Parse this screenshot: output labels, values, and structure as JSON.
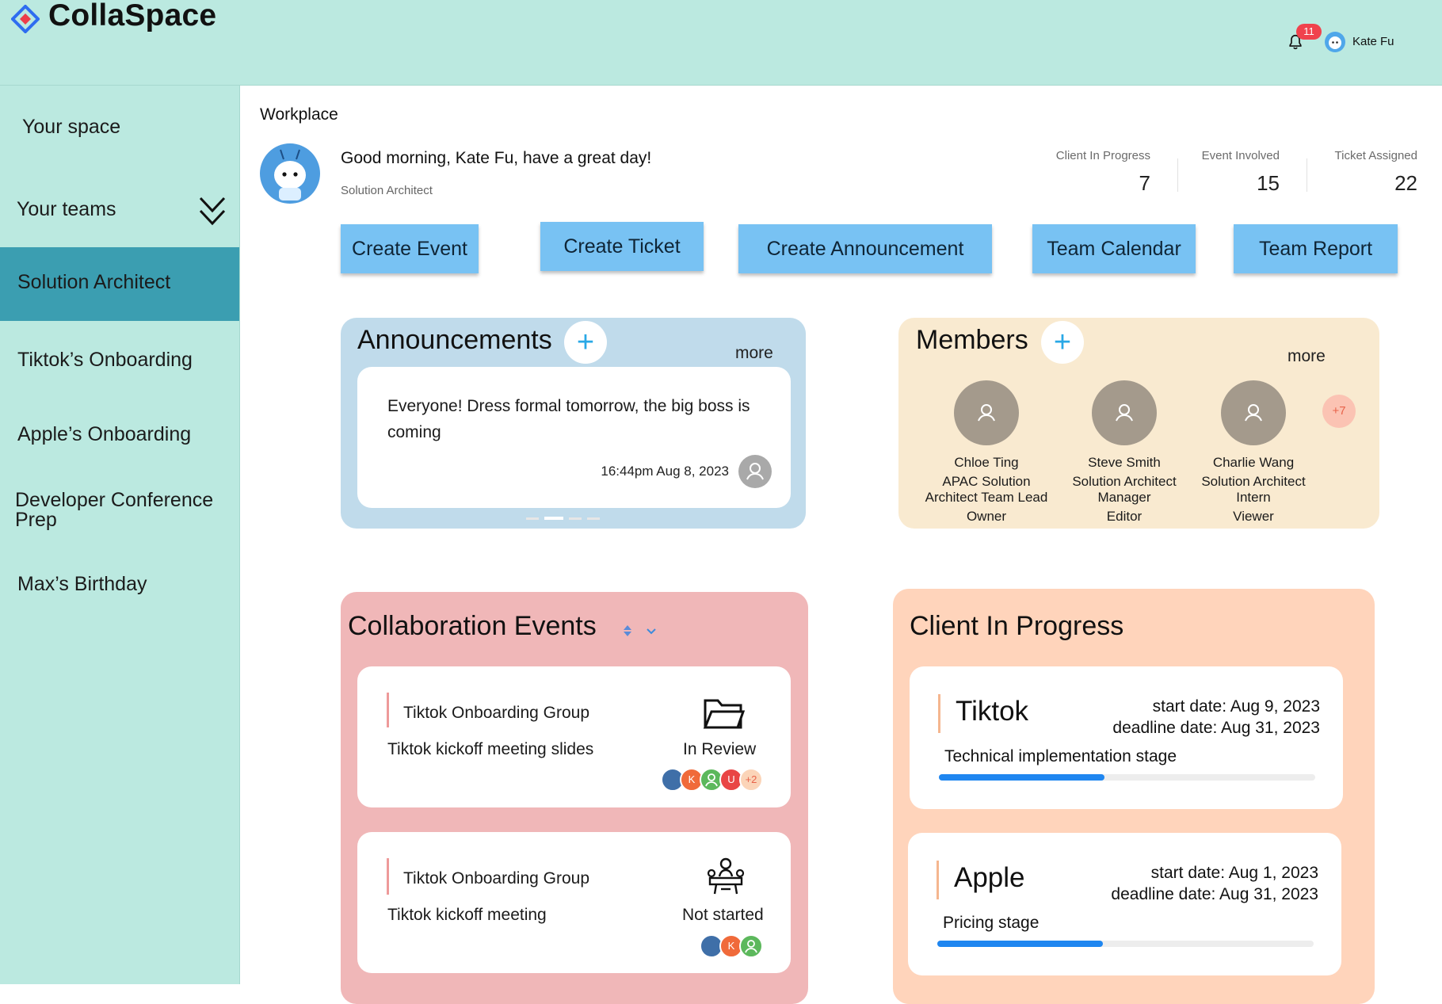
{
  "app": {
    "name": "CollaSpace"
  },
  "header": {
    "notification_count": "11",
    "user_name": "Kate Fu"
  },
  "sidebar": {
    "your_space": "Your space",
    "your_teams": "Your teams",
    "teams": [
      {
        "label": "Solution Architect",
        "active": true
      },
      {
        "label": "Tiktok’s Onboarding"
      },
      {
        "label": "Apple’s Onboarding"
      },
      {
        "label": "Developer Conference Prep"
      },
      {
        "label": "Max’s Birthday"
      }
    ]
  },
  "main": {
    "section_label": "Workplace",
    "greeting": "Good morning, Kate Fu, have a great day!",
    "role": "Solution Architect",
    "stats": [
      {
        "label": "Client In Progress",
        "value": "7"
      },
      {
        "label": "Event Involved",
        "value": "15"
      },
      {
        "label": "Ticket Assigned",
        "value": "22"
      }
    ],
    "actions": [
      "Create Event",
      "Create Ticket",
      "Create Announcement",
      "Team Calendar",
      "Team Report"
    ]
  },
  "announcements": {
    "title": "Announcements",
    "add_label": "+",
    "more_label": "more",
    "item": {
      "text": "Everyone! Dress formal tomorrow, the big boss is coming",
      "timestamp": "16:44pm Aug 8, 2023"
    }
  },
  "members": {
    "title": "Members",
    "add_label": "+",
    "more_label": "more",
    "overflow": "+7",
    "list": [
      {
        "name": "Chloe Ting",
        "position": "APAC Solution Architect Team Lead",
        "role": "Owner"
      },
      {
        "name": "Steve Smith",
        "position": "Solution Architect Manager",
        "role": "Editor"
      },
      {
        "name": "Charlie Wang",
        "position": "Solution Architect Intern",
        "role": "Viewer"
      }
    ]
  },
  "events": {
    "title": "Collaboration Events",
    "items": [
      {
        "group": "Tiktok Onboarding Group",
        "title": "Tiktok kickoff meeting slides",
        "status": "In Review",
        "icon": "folder-icon",
        "participants": [
          "K",
          "U"
        ],
        "extra": "+2"
      },
      {
        "group": "Tiktok Onboarding Group",
        "title": "Tiktok kickoff meeting",
        "status": "Not started",
        "icon": "meeting-icon",
        "participants": [
          "K"
        ]
      }
    ]
  },
  "clients": {
    "title": "Client In Progress",
    "items": [
      {
        "name": "Tiktok",
        "start": "start date: Aug 9, 2023",
        "deadline": "deadline date: Aug 31, 2023",
        "stage": "Technical implementation stage",
        "progress": 0.44
      },
      {
        "name": "Apple",
        "start": "start date: Aug 1, 2023",
        "deadline": "deadline date: Aug 31, 2023",
        "stage": "Pricing stage",
        "progress": 0.44
      }
    ]
  },
  "colors": {
    "header_bg": "#bbe9e0",
    "active_item": "#3b9eb1",
    "action_button": "#78c2f3",
    "announcements_bg": "#c0dbeb",
    "members_bg": "#f9ead0",
    "events_bg": "#f0b7b8",
    "clients_bg": "#ffd4bb",
    "progress": "#1f86f0"
  }
}
